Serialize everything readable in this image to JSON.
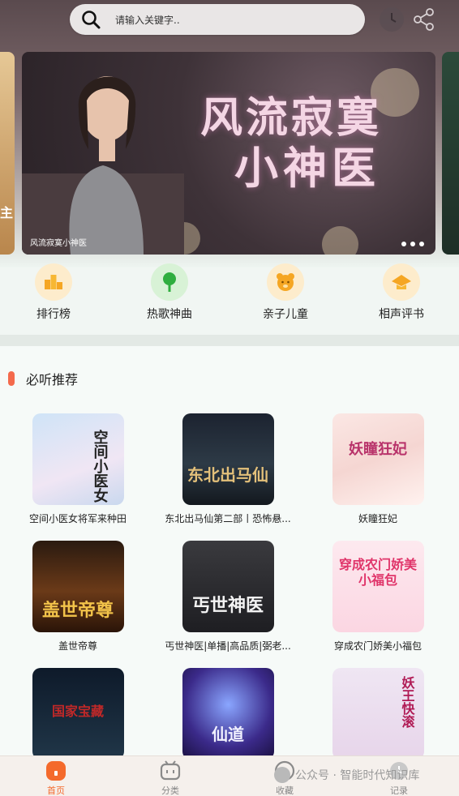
{
  "search": {
    "placeholder": "请输入关键字.."
  },
  "header": {
    "history_icon": "clock-icon",
    "share_icon": "share-icon"
  },
  "banner": {
    "title_line1": "风流寂寞",
    "title_line2": "小神医",
    "caption": "风流寂寞小神医",
    "page_count": 3,
    "left_peek_text": "家主",
    "left_peek_text_small": "主"
  },
  "quick": [
    {
      "label": "排行榜",
      "icon": "ranking-icon",
      "color": "#f5a623"
    },
    {
      "label": "热歌神曲",
      "icon": "music-note-icon",
      "color": "#3bb54a"
    },
    {
      "label": "亲子儿童",
      "icon": "bear-icon",
      "color": "#f5a623"
    },
    {
      "label": "相声评书",
      "icon": "hat-icon",
      "color": "#f5a623"
    }
  ],
  "section": {
    "title": "必听推荐"
  },
  "albums": [
    {
      "name": "空间小医女将军来种田",
      "cover_text": "空间小医女"
    },
    {
      "name": "东北出马仙第二部丨恐怖悬...",
      "cover_text": "东北出马仙"
    },
    {
      "name": "妖瞳狂妃",
      "cover_text": "妖瞳狂妃"
    },
    {
      "name": "盖世帝尊",
      "cover_text": "盖世帝尊"
    },
    {
      "name": "丐世神医|单播|高品质|弼老...",
      "cover_text": "丐世神医"
    },
    {
      "name": "穿成农门娇美小福包",
      "cover_text": "穿成农门娇美小福包"
    },
    {
      "name": "",
      "cover_text": "国家宝藏"
    },
    {
      "name": "",
      "cover_text": "仙道"
    },
    {
      "name": "",
      "cover_text": "妖王快滚"
    }
  ],
  "nav": [
    {
      "label": "首页",
      "icon": "home-icon",
      "active": true
    },
    {
      "label": "分类",
      "icon": "category-icon",
      "active": false
    },
    {
      "label": "收藏",
      "icon": "favorite-icon",
      "active": false
    },
    {
      "label": "记录",
      "icon": "history-icon",
      "active": false
    }
  ],
  "watermark": "公众号 · 智能时代知识库",
  "colors": {
    "accent": "#f46a2c",
    "section_bar": "#f46a4c"
  }
}
